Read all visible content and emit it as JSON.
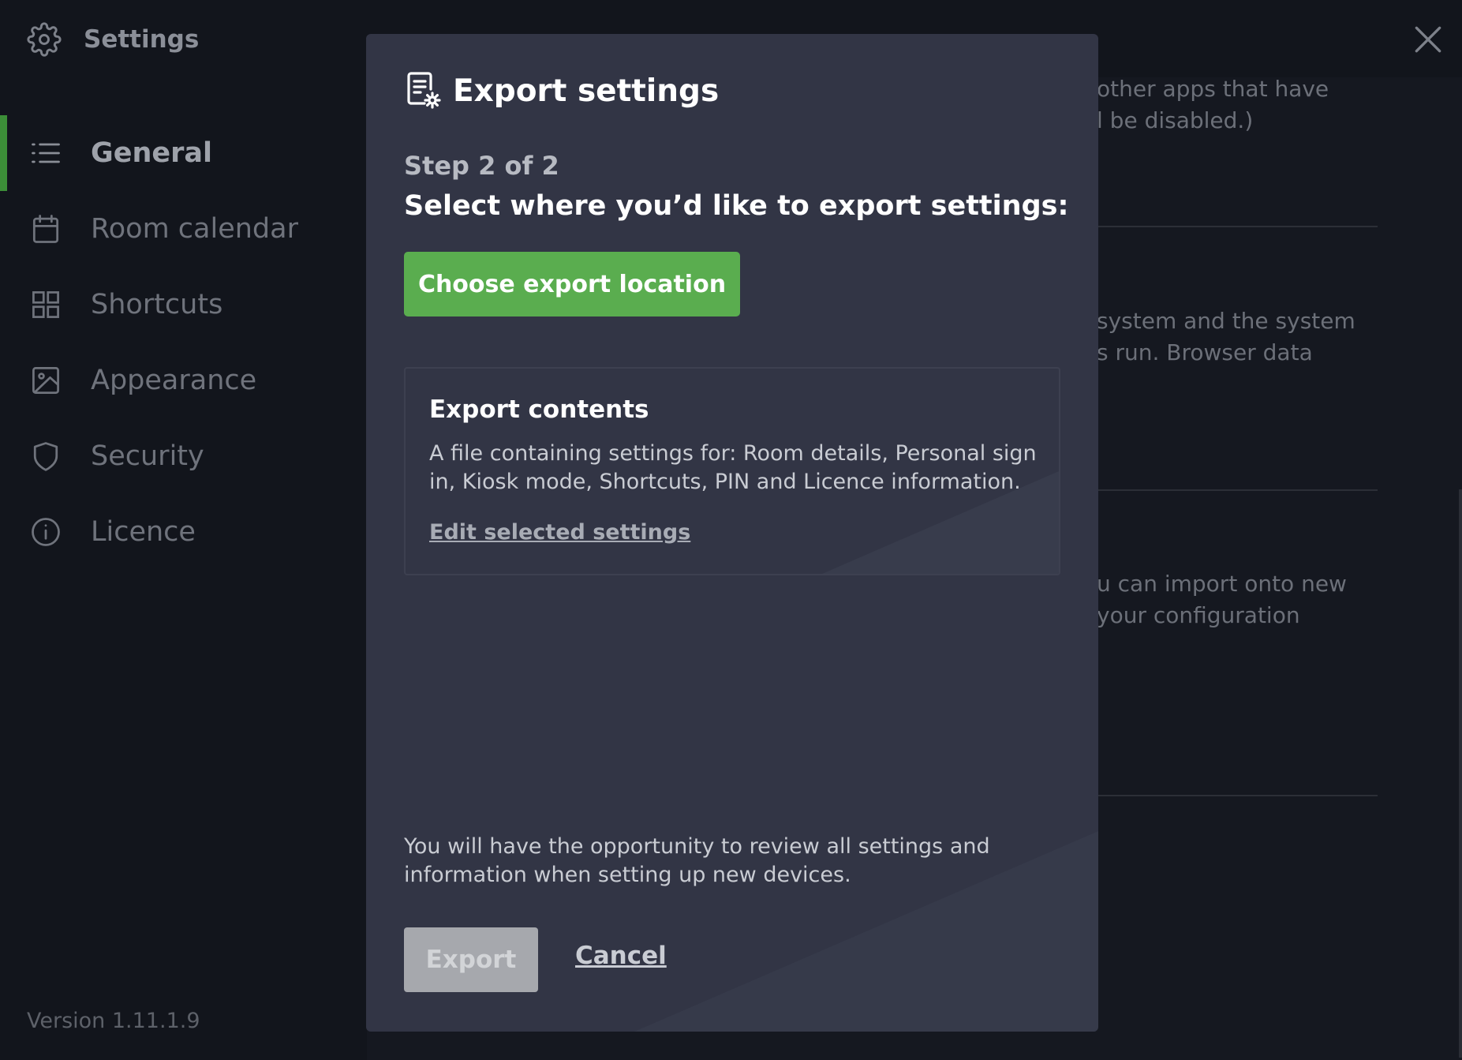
{
  "sidebar": {
    "title": "Settings",
    "items": [
      {
        "label": "General",
        "icon": "list-icon",
        "active": true
      },
      {
        "label": "Room calendar",
        "icon": "calendar-icon",
        "active": false
      },
      {
        "label": "Shortcuts",
        "icon": "grid-icon",
        "active": false
      },
      {
        "label": "Appearance",
        "icon": "image-icon",
        "active": false
      },
      {
        "label": "Security",
        "icon": "shield-icon",
        "active": false
      },
      {
        "label": "Licence",
        "icon": "info-icon",
        "active": false
      }
    ],
    "version": "Version 1.11.1.9"
  },
  "background": {
    "line1": "other apps that have",
    "line2": "l be disabled.)",
    "line3": "system and the system",
    "line4": "s run. Browser data",
    "line5": "u can import onto new",
    "line6": "your configuration"
  },
  "dialog": {
    "title": "Export settings",
    "step": "Step 2 of 2",
    "instruction": "Select where you’d like to export settings:",
    "choose_button": "Choose export location",
    "contents_title": "Export contents",
    "contents_desc": "A file containing settings for: Room details, Personal sign in, Kiosk mode, Shortcuts, PIN and Licence information.",
    "edit_link": "Edit selected settings",
    "note": "You will have the opportunity to review all settings and information when setting up new devices.",
    "export_button": "Export",
    "cancel_link": "Cancel"
  },
  "colors": {
    "accent_green": "#5aad4f",
    "active_indicator": "#3c8e38",
    "modal_bg": "#323545",
    "disabled_button": "#a6a8ad"
  }
}
